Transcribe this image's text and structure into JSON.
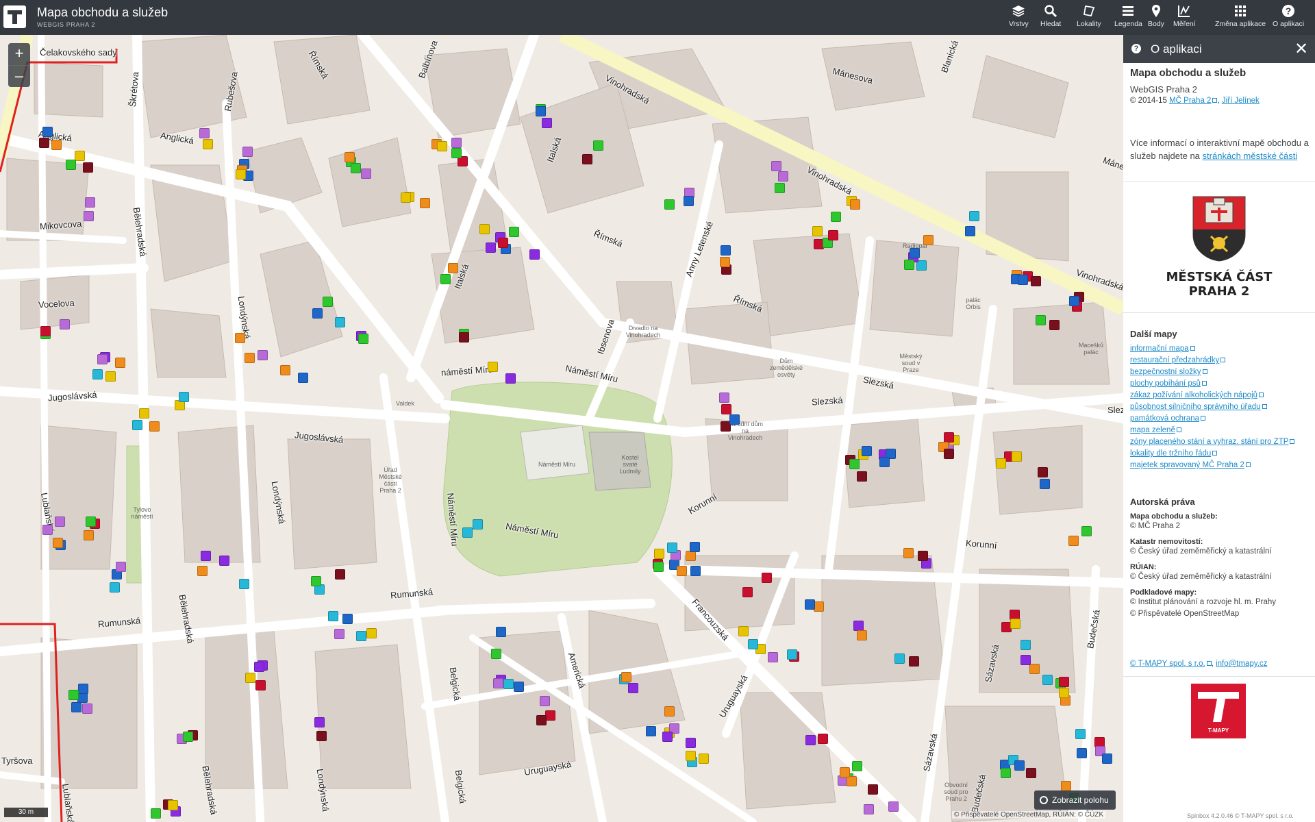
{
  "app": {
    "title": "Mapa obchodu a služeb",
    "subtitle": "WEBGIS PRAHA 2"
  },
  "toolbar": [
    {
      "label": "Vrstvy",
      "icon": "layers-icon"
    },
    {
      "label": "Hledat",
      "icon": "search-icon"
    },
    {
      "label": "Lokality",
      "icon": "location-shape-icon"
    },
    {
      "label": "Legenda",
      "icon": "legend-list-icon"
    },
    {
      "label": "Body",
      "icon": "map-pin-icon"
    },
    {
      "label": "Měření",
      "icon": "ruler-icon"
    },
    {
      "label": "Změna aplikace",
      "icon": "app-grid-icon"
    },
    {
      "label": "O aplikaci",
      "icon": "info-icon"
    }
  ],
  "map": {
    "zoom_in": "+",
    "zoom_out": "–",
    "locate_button": "Zobrazit polohu",
    "scale": "30 m",
    "attribution": "© Přispěvatelé OpenStreetMap, RÚIAN: © ČÚZK",
    "streets": [
      "Čelakovského sady",
      "Římská",
      "Balbínova",
      "Mánesova",
      "Blanická",
      "Vinohradská",
      "Anglická",
      "Anglická",
      "Rubešova",
      "Škrétova",
      "Mikovcova",
      "Bělehradská",
      "Italská",
      "Italská",
      "Římská",
      "Vocelova",
      "Londýnská",
      "Anny Letenské",
      "Ibsenova",
      "Římská",
      "Jugoslávská",
      "náměstí Míru",
      "Náměstí Míru",
      "Slezská",
      "Slezská",
      "Jugoslávská",
      "Lublaňská",
      "Korunní",
      "Korunní",
      "Náměstí Míru",
      "Náměstí Míru",
      "Rumunská",
      "Rumunská",
      "Bělehradská",
      "Londýnská",
      "Francouzská",
      "Americká",
      "Belgická",
      "Uruguayská",
      "Uruguayská",
      "Sázavská",
      "Budečská",
      "Tyršova",
      "Bělehradská",
      "Vinohradská",
      "Vinohradská",
      "Sázavská",
      "Belgická",
      "Londýnská",
      "Lublaňská",
      "Budečská",
      "Máne",
      "Slez"
    ],
    "buildings": [
      "Náměstí Míru",
      "Kostel svaté Ludmily",
      "Divadlo na Vinohradech",
      "Úřad Městské části Praha 2",
      "Valdek",
      "Tylovo náměstí",
      "Národní dům na Vinohradech",
      "Dům zemědělské osvěty",
      "Městský soud v Praze",
      "Radiopal",
      "palác Orbis",
      "Macešků palác",
      "Obvodní soud pro Prahu 2"
    ]
  },
  "panel": {
    "title": "O aplikaci",
    "app_name": "Mapa obchodu a služeb",
    "app_sub": "WebGIS Praha 2",
    "copyright_prefix": "© 2014-15",
    "copyright_link1": "MČ Praha 2",
    "copyright_link2": "Jiří Jelínek",
    "info_text": "Více informací o interaktivní mapě obchodu a služeb najdete na",
    "info_link": "stránkách městské části",
    "district_line1": "MĚSTSKÁ ČÁST",
    "district_line2": "PRAHA 2",
    "other_maps_title": "Další mapy",
    "other_maps": [
      "informační mapa",
      "restaurační předzahrádky",
      "bezpečnostní složky",
      "plochy pobíhání psů",
      "zákaz požívání alkoholických nápojů",
      "působnost silničního správního úřadu",
      "památková ochrana",
      "mapa zeleně",
      "zóny placeného stání a vyhraz. stání pro ZTP",
      "lokality dle tržního řádu",
      "majetek spravovaný MČ Praha 2"
    ],
    "rights_title": "Autorská práva",
    "rights": [
      {
        "label": "Mapa obchodu a služeb:",
        "values": [
          "© MČ Praha 2"
        ]
      },
      {
        "label": "Katastr nemovitostí:",
        "values": [
          "© Český úřad zeměměřický a katastrální"
        ]
      },
      {
        "label": "RÚIAN:",
        "values": [
          "© Český úřad zeměměřický a katastrální"
        ]
      },
      {
        "label": "Podkladové mapy:",
        "values": [
          "© Institut plánování a rozvoje hl. m. Prahy",
          "© Přispěvatelé OpenStreetMap"
        ]
      }
    ],
    "footer_link1": "© T-MAPY spol. s r.o.",
    "footer_link2": "info@tmapy.cz",
    "tmapy_logo_text": "T-MAPY",
    "version": "Spinbox 4.2.0.46 © T-MAPY spol. s r.o."
  },
  "colors": {
    "topbar": "#33393f",
    "panel_header": "#3c4248",
    "map_land": "#efebe4",
    "building": "#d9d0c9",
    "park": "#cddfae",
    "main_road": "#f8f6c2",
    "district_border": "#e02020",
    "link": "#1c8ac9",
    "tmapy_red": "#d7172f",
    "poi_palette": [
      "#7a0f1d",
      "#8a2be2",
      "#1e66c8",
      "#f08c1c",
      "#2ec82e",
      "#26b8d8",
      "#e8c400",
      "#c8102e",
      "#b86ad8"
    ]
  }
}
